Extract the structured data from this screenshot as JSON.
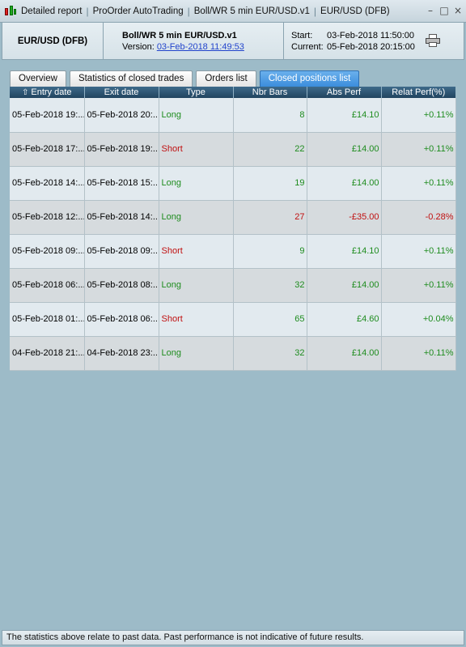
{
  "titlebar": {
    "segments": [
      "Detailed report",
      "ProOrder AutoTrading",
      "Boll/WR 5 min EUR/USD.v1",
      "EUR/USD (DFB)"
    ],
    "buttons": [
      "–",
      "□",
      "×"
    ]
  },
  "header": {
    "instrument": "EUR/USD (DFB)",
    "strategy": "Boll/WR 5 min EUR/USD.v1",
    "version_label": "Version:",
    "version_date": "03-Feb-2018 11:49:53",
    "start_label": "Start:",
    "start_value": "03-Feb-2018 11:50:00",
    "current_label": "Current:",
    "current_value": "05-Feb-2018 20:15:00",
    "print_icon": "printer-icon"
  },
  "tabs": [
    {
      "label": "Overview",
      "active": false
    },
    {
      "label": "Statistics of closed trades",
      "active": false
    },
    {
      "label": "Orders list",
      "active": false
    },
    {
      "label": "Closed positions list",
      "active": true
    }
  ],
  "table": {
    "sort_icon": "⇧",
    "columns": [
      "Entry date",
      "Exit date",
      "Type",
      "Nbr Bars",
      "Abs Perf",
      "Relat Perf(%)"
    ],
    "rows": [
      {
        "entry": "05-Feb-2018 19:...",
        "exit": "05-Feb-2018 20:...",
        "type": "Long",
        "bars": "8",
        "abs": "£14.10",
        "rel": "+0.11%"
      },
      {
        "entry": "05-Feb-2018 17:...",
        "exit": "05-Feb-2018 19:...",
        "type": "Short",
        "bars": "22",
        "abs": "£14.00",
        "rel": "+0.11%"
      },
      {
        "entry": "05-Feb-2018 14:...",
        "exit": "05-Feb-2018 15:...",
        "type": "Long",
        "bars": "19",
        "abs": "£14.00",
        "rel": "+0.11%"
      },
      {
        "entry": "05-Feb-2018 12:...",
        "exit": "05-Feb-2018 14:...",
        "type": "Long",
        "bars": "27",
        "abs": "-£35.00",
        "rel": "-0.28%"
      },
      {
        "entry": "05-Feb-2018 09:...",
        "exit": "05-Feb-2018 09:...",
        "type": "Short",
        "bars": "9",
        "abs": "£14.10",
        "rel": "+0.11%"
      },
      {
        "entry": "05-Feb-2018 06:...",
        "exit": "05-Feb-2018 08:...",
        "type": "Long",
        "bars": "32",
        "abs": "£14.00",
        "rel": "+0.11%"
      },
      {
        "entry": "05-Feb-2018 01:...",
        "exit": "05-Feb-2018 06:...",
        "type": "Short",
        "bars": "65",
        "abs": "£4.60",
        "rel": "+0.04%"
      },
      {
        "entry": "04-Feb-2018 21:...",
        "exit": "04-Feb-2018 23:...",
        "type": "Long",
        "bars": "32",
        "abs": "£14.00",
        "rel": "+0.11%"
      }
    ]
  },
  "statusbar": {
    "text": "The statistics above relate to past data. Past performance is not indicative of future results."
  }
}
